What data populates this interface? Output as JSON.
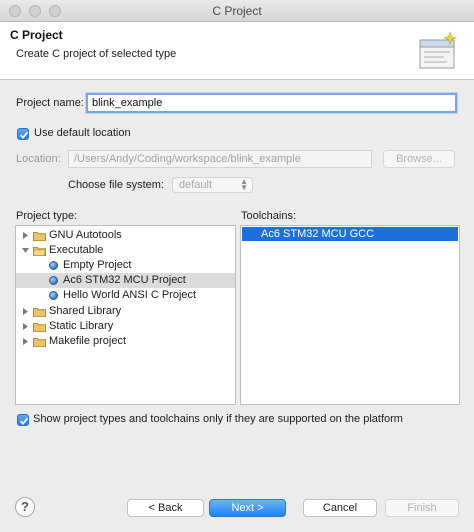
{
  "window": {
    "title": "C Project"
  },
  "header": {
    "title": "C Project",
    "description": "Create C project of selected type",
    "icon": "wizard-banner-icon"
  },
  "project_name": {
    "label": "Project name:",
    "value": "blink_example"
  },
  "use_default_location": {
    "label": "Use default location",
    "checked": true
  },
  "location": {
    "label": "Location:",
    "value": "/Users/Andy/Coding/workspace/blink_example",
    "browse_label": "Browse..."
  },
  "file_system": {
    "label": "Choose file system:",
    "selected": "default"
  },
  "project_type": {
    "label": "Project type:",
    "items": [
      {
        "label": "GNU Autotools",
        "icon": "folder-icon",
        "expanded": false,
        "level": 0
      },
      {
        "label": "Executable",
        "icon": "folder-icon",
        "expanded": true,
        "level": 0
      },
      {
        "label": "Empty Project",
        "icon": "bullet-icon",
        "level": 1
      },
      {
        "label": "Ac6 STM32 MCU Project",
        "icon": "bullet-icon",
        "level": 1,
        "selected": true
      },
      {
        "label": "Hello World ANSI C Project",
        "icon": "bullet-icon",
        "level": 1
      },
      {
        "label": "Shared Library",
        "icon": "folder-icon",
        "expanded": false,
        "level": 0
      },
      {
        "label": "Static Library",
        "icon": "folder-icon",
        "expanded": false,
        "level": 0
      },
      {
        "label": "Makefile project",
        "icon": "folder-icon",
        "expanded": false,
        "level": 0
      }
    ]
  },
  "toolchains": {
    "label": "Toolchains:",
    "items": [
      {
        "label": "Ac6 STM32 MCU GCC",
        "selected": true
      }
    ]
  },
  "show_supported": {
    "label": "Show project types and toolchains only if they are supported on the platform",
    "checked": true
  },
  "footer": {
    "help": "?",
    "back": "< Back",
    "next": "Next >",
    "cancel": "Cancel",
    "finish": "Finish"
  },
  "colors": {
    "accent": "#1c6fdc",
    "primary_button": "#1f83f5",
    "checkbox": "#2f7de6"
  }
}
